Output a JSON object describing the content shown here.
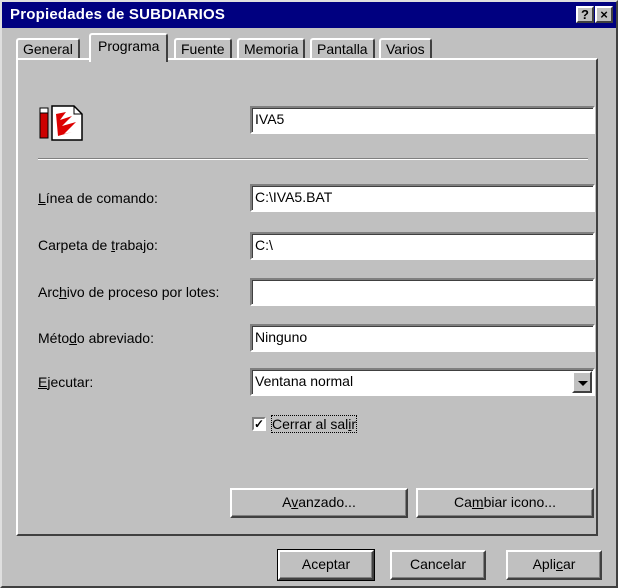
{
  "window": {
    "title": "Propiedades de SUBDIARIOS",
    "help_glyph": "?",
    "close_glyph": "×"
  },
  "tabs": [
    {
      "label": "General"
    },
    {
      "label": "Programa"
    },
    {
      "label": "Fuente"
    },
    {
      "label": "Memoria"
    },
    {
      "label": "Pantalla"
    },
    {
      "label": "Varios"
    }
  ],
  "program": {
    "name_value": "IVA5",
    "fields": {
      "command_line": {
        "label_pre": "",
        "label_u": "L",
        "label_post": "ínea de comando:",
        "value": "C:\\IVA5.BAT"
      },
      "working_dir": {
        "label_pre": "Carpeta de ",
        "label_u": "t",
        "label_post": "rabajo:",
        "value": "C:\\"
      },
      "batch_file": {
        "label_pre": "Arc",
        "label_u": "h",
        "label_post": "ivo de proceso por lotes:",
        "value": ""
      },
      "shortcut": {
        "label_pre": "Méto",
        "label_u": "d",
        "label_post": "o abreviado:",
        "value": "Ninguno"
      },
      "run": {
        "label_pre": "",
        "label_u": "E",
        "label_post": "jecutar:",
        "value": "Ventana normal"
      }
    },
    "close_on_exit": {
      "label_pre": "Cerrar al sal",
      "label_u": "i",
      "label_post": "r",
      "checked": true,
      "check_glyph": "✓"
    },
    "advanced_button": {
      "pre": "A",
      "u": "v",
      "post": "anzado..."
    },
    "change_icon_button": {
      "pre": "Ca",
      "u": "m",
      "post": "biar icono..."
    }
  },
  "footer": {
    "ok": "Aceptar",
    "cancel": "Cancelar",
    "apply": {
      "pre": "Apli",
      "u": "c",
      "post": "ar"
    }
  }
}
